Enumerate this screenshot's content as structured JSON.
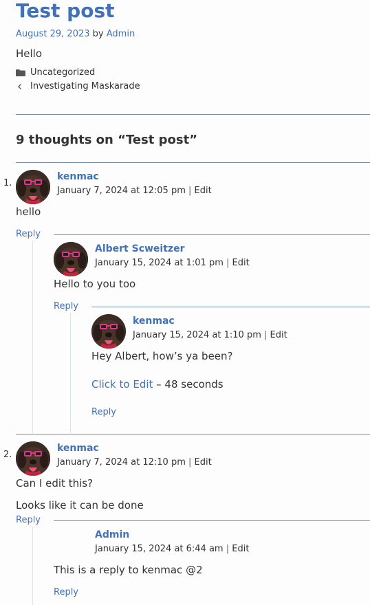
{
  "post": {
    "title": "Test post",
    "date": "August 29, 2023",
    "by_word": "by",
    "author": "Admin",
    "body": "Hello",
    "category": "Uncategorized",
    "prev_post": "Investigating Maskarade"
  },
  "comments_title": "9 thoughts on “Test post”",
  "labels": {
    "reply": "Reply",
    "edit": "Edit",
    "separator": "|"
  },
  "comments": [
    {
      "number": "1.",
      "author": "kenmac",
      "timestamp": "January 7, 2024 at 12:05 pm",
      "text": "hello",
      "replies": [
        {
          "author": "Albert Scweitzer",
          "timestamp": "January 15, 2024 at 1:01 pm",
          "text": "Hello to you too",
          "replies": [
            {
              "author": "kenmac",
              "timestamp": "January 15, 2024 at 1:10 pm",
              "text": "Hey Albert, how’s ya been?",
              "edit_link": "Click to Edit",
              "edit_timer": " – 48 seconds"
            }
          ]
        }
      ]
    },
    {
      "number": "2.",
      "author": "kenmac",
      "timestamp": "January 7, 2024 at 12:10 pm",
      "text": "Can I edit this?",
      "text2": "Looks like it can be done",
      "replies": [
        {
          "author": "Admin",
          "timestamp": "January 15, 2024 at 6:44 am",
          "text": "This is a reply to kenmac @2"
        }
      ]
    }
  ],
  "colors": {
    "link": "#4272b5",
    "text": "#333333",
    "rule": "#7590b8",
    "background": "#fdfdfd"
  },
  "icons": {
    "category": "folder-icon",
    "prev": "chevron-left-icon",
    "avatar": "dog-with-sunglasses-avatar"
  }
}
